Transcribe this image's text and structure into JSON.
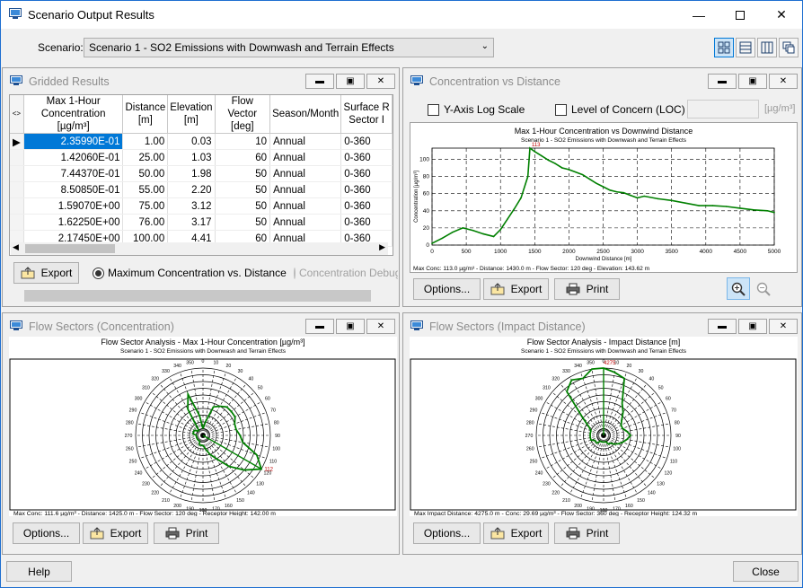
{
  "window": {
    "title": "Scenario Output Results"
  },
  "scenario": {
    "label": "Scenario:",
    "value": "Scenario 1 - SO2 Emissions with Downwash and Terrain Effects"
  },
  "gridded": {
    "title": "Gridded Results",
    "columns": [
      "Max 1-Hour Concentration [µg/m³]",
      "Distance [m]",
      "Elevation [m]",
      "Flow Vector [deg]",
      "Season/Month",
      "Surface R Sector I"
    ],
    "rows": [
      [
        "2.35990E-01",
        "1.00",
        "0.03",
        "10",
        "Annual",
        "0-360"
      ],
      [
        "1.42060E-01",
        "25.00",
        "1.03",
        "60",
        "Annual",
        "0-360"
      ],
      [
        "7.44370E-01",
        "50.00",
        "1.98",
        "50",
        "Annual",
        "0-360"
      ],
      [
        "8.50850E-01",
        "55.00",
        "2.20",
        "50",
        "Annual",
        "0-360"
      ],
      [
        "1.59070E+00",
        "75.00",
        "3.12",
        "50",
        "Annual",
        "0-360"
      ],
      [
        "1.62250E+00",
        "76.00",
        "3.17",
        "50",
        "Annual",
        "0-360"
      ],
      [
        "2.17450E+00",
        "100.00",
        "4.41",
        "60",
        "Annual",
        "0-360"
      ]
    ],
    "export_label": "Export",
    "radio_max": "Maximum Concentration vs. Distance",
    "radio_debug": "Concentration Debug"
  },
  "conc_vs_dist": {
    "title": "Concentration vs Distance",
    "log_label": "Y-Axis Log Scale",
    "loc_label": "Level of Concern (LOC)",
    "loc_unit": "[µg/m³]",
    "options_label": "Options...",
    "export_label": "Export",
    "print_label": "Print",
    "footnote": "Max Conc: 113.0 µg/m³ - Distance: 1430.0 m - Flow Sector: 120 deg - Elevation: 143.62 m"
  },
  "chart_data": [
    {
      "type": "line",
      "title": "Max 1-Hour Concentration vs Downwind Distance",
      "subtitle": "Scenario 1 - SO2 Emissions with Downwash and Terrain Effects",
      "xlabel": "Downwind Distance [m]",
      "ylabel": "Concentration [µg/m³]",
      "xlim": [
        0,
        5000
      ],
      "ylim": [
        0,
        113
      ],
      "xticks": [
        0,
        500,
        1000,
        1500,
        2000,
        2500,
        3000,
        3500,
        4000,
        4500,
        5000
      ],
      "yticks": [
        0,
        20,
        40,
        60,
        80,
        100
      ],
      "grid": true,
      "peak_label": "113",
      "series": [
        {
          "color": "#008000",
          "x": [
            0,
            150,
            300,
            450,
            600,
            750,
            900,
            1000,
            1100,
            1200,
            1300,
            1400,
            1430,
            1500,
            1600,
            1700,
            1800,
            1900,
            2000,
            2100,
            2200,
            2300,
            2400,
            2500,
            2600,
            2700,
            2800,
            2900,
            3000,
            3100,
            3300,
            3500,
            3700,
            3900,
            4100,
            4300,
            4500,
            4700,
            4900,
            5000
          ],
          "y": [
            2,
            8,
            15,
            20,
            17,
            13,
            10,
            18,
            30,
            42,
            55,
            80,
            113,
            109,
            104,
            99,
            95,
            90,
            88,
            85,
            82,
            77,
            72,
            68,
            64,
            62,
            61,
            58,
            55,
            57,
            54,
            52,
            49,
            46,
            46,
            45,
            43,
            41,
            40,
            38
          ]
        }
      ]
    },
    {
      "type": "polar",
      "title": "Flow Sector Analysis - Max 1-Hour Concentration [µg/m³]",
      "subtitle": "Scenario 1 - SO2 Emissions with Downwash and Terrain Effects",
      "angles": [
        0,
        10,
        20,
        30,
        40,
        50,
        60,
        70,
        80,
        90,
        100,
        110,
        120,
        130,
        140,
        150,
        160,
        170,
        180,
        190,
        200,
        210,
        220,
        230,
        240,
        250,
        260,
        270,
        280,
        290,
        300,
        310,
        320,
        330,
        340,
        350
      ],
      "values": [
        0.1,
        0.2,
        0.45,
        0.5,
        0.55,
        0.55,
        0.55,
        0.5,
        0.5,
        0.55,
        0.6,
        0.85,
        1.0,
        0.8,
        0.6,
        0.4,
        0.3,
        0.2,
        0.15,
        0.15,
        0.15,
        0.1,
        0.1,
        0.1,
        0.1,
        0.1,
        0.1,
        0.1,
        0.15,
        0.15,
        0.15,
        0.1,
        0.1,
        0.45,
        0.65,
        0.3
      ],
      "peak_label": "112"
    },
    {
      "type": "polar",
      "title": "Flow Sector Analysis - Impact Distance [m]",
      "subtitle": "Scenario 1 - SO2 Emissions with Downwash and Terrain Effects",
      "angles": [
        0,
        10,
        20,
        30,
        40,
        50,
        60,
        70,
        80,
        90,
        100,
        110,
        120,
        130,
        140,
        150,
        160,
        170,
        180,
        190,
        200,
        210,
        220,
        230,
        240,
        250,
        260,
        270,
        280,
        290,
        300,
        310,
        320,
        330,
        340,
        350
      ],
      "values": [
        1.0,
        0.95,
        0.9,
        0.55,
        0.45,
        0.35,
        0.3,
        0.3,
        0.35,
        0.4,
        0.35,
        0.3,
        0.25,
        0.2,
        0.15,
        0.15,
        0.1,
        0.1,
        0.1,
        0.1,
        0.1,
        0.1,
        0.15,
        0.15,
        0.15,
        0.2,
        0.2,
        0.2,
        0.2,
        0.2,
        0.25,
        0.4,
        0.85,
        0.95,
        0.9,
        1.0
      ],
      "peak_label": "4275"
    }
  ],
  "flow_conc": {
    "title": "Flow Sectors (Concentration)",
    "options_label": "Options...",
    "export_label": "Export",
    "print_label": "Print",
    "footnote": "Max Conc: 111.6 µg/m³ - Distance: 1425.0 m - Flow Sector: 120 deg - Receptor Height: 142.00 m"
  },
  "flow_dist": {
    "title": "Flow Sectors (Impact Distance)",
    "options_label": "Options...",
    "export_label": "Export",
    "print_label": "Print",
    "footnote": "Max Impact Distance: 4275.0 m - Conc: 29.69 µg/m³ - Flow Sector: 360 deg - Receptor Height: 124.32 m"
  },
  "footer": {
    "help_label": "Help",
    "close_label": "Close"
  }
}
